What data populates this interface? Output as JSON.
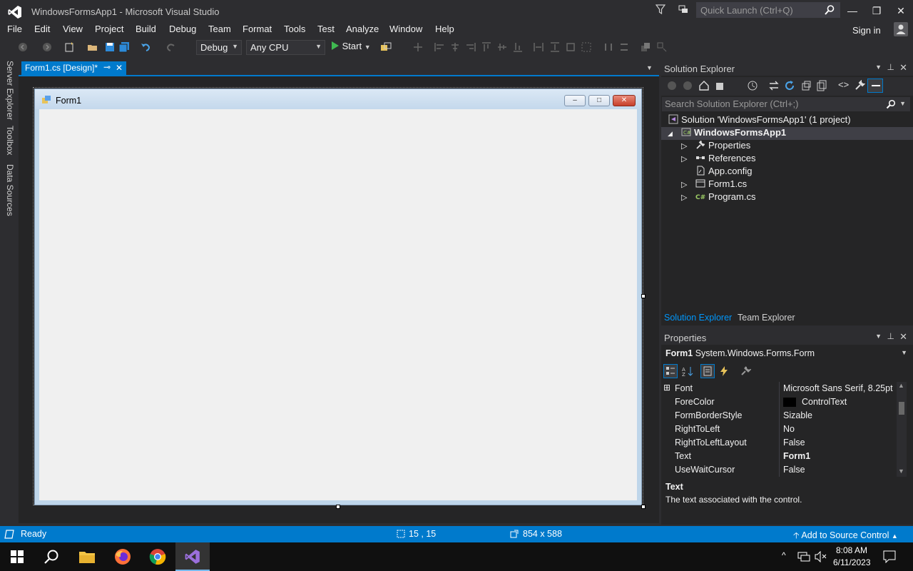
{
  "window": {
    "title": "WindowsFormsApp1 - Microsoft Visual Studio",
    "quick_launch_placeholder": "Quick Launch (Ctrl+Q)",
    "sign_in": "Sign in"
  },
  "menu": [
    "File",
    "Edit",
    "View",
    "Project",
    "Build",
    "Debug",
    "Team",
    "Format",
    "Tools",
    "Test",
    "Analyze",
    "Window",
    "Help"
  ],
  "toolbar": {
    "configuration": "Debug",
    "platform": "Any CPU",
    "start_label": "Start"
  },
  "left_rail": [
    "Server Explorer",
    "Toolbox",
    "Data Sources"
  ],
  "document_tab": {
    "label": "Form1.cs [Design]*",
    "pin_glyph": "⊸",
    "close_glyph": "✕"
  },
  "designer": {
    "form_caption": "Form1"
  },
  "solution_explorer": {
    "title": "Solution Explorer",
    "search_placeholder": "Search Solution Explorer (Ctrl+;)",
    "tree": [
      {
        "label": "Solution 'WindowsFormsApp1' (1 project)",
        "icon": "solution-icon",
        "expander": ""
      },
      {
        "label": "WindowsFormsApp1",
        "icon": "csharp-project-icon",
        "expander": "◢"
      },
      {
        "label": "Properties",
        "icon": "wrench-icon",
        "expander": "▷"
      },
      {
        "label": "References",
        "icon": "references-icon",
        "expander": "▷"
      },
      {
        "label": "App.config",
        "icon": "config-file-icon",
        "expander": ""
      },
      {
        "label": "Form1.cs",
        "icon": "form-file-icon",
        "expander": "▷"
      },
      {
        "label": "Program.cs",
        "icon": "csharp-file-icon",
        "expander": "▷"
      }
    ],
    "tabs": [
      "Solution Explorer",
      "Team Explorer"
    ]
  },
  "properties": {
    "title": "Properties",
    "object_name": "Form1",
    "object_type": "System.Windows.Forms.Form",
    "rows": [
      {
        "key": "Font",
        "value": "Microsoft Sans Serif, 8.25pt",
        "expander": "⊞"
      },
      {
        "key": "ForeColor",
        "value": "ControlText",
        "expander": ""
      },
      {
        "key": "FormBorderStyle",
        "value": "Sizable",
        "expander": ""
      },
      {
        "key": "RightToLeft",
        "value": "No",
        "expander": ""
      },
      {
        "key": "RightToLeftLayout",
        "value": "False",
        "expander": ""
      },
      {
        "key": "Text",
        "value": "Form1",
        "expander": ""
      },
      {
        "key": "UseWaitCursor",
        "value": "False",
        "expander": ""
      }
    ],
    "desc_title": "Text",
    "desc_text": "The text associated with the control."
  },
  "status": {
    "ready": "Ready",
    "position": "15 , 15",
    "size": "854 x 588",
    "source_control": "Add to Source Control"
  },
  "taskbar": {
    "time": "8:08 AM",
    "date": "6/11/2023"
  },
  "colors": {
    "accent": "#007acc",
    "background": "#2d2d30",
    "panel": "#252526",
    "selection": "#3f3f46"
  }
}
